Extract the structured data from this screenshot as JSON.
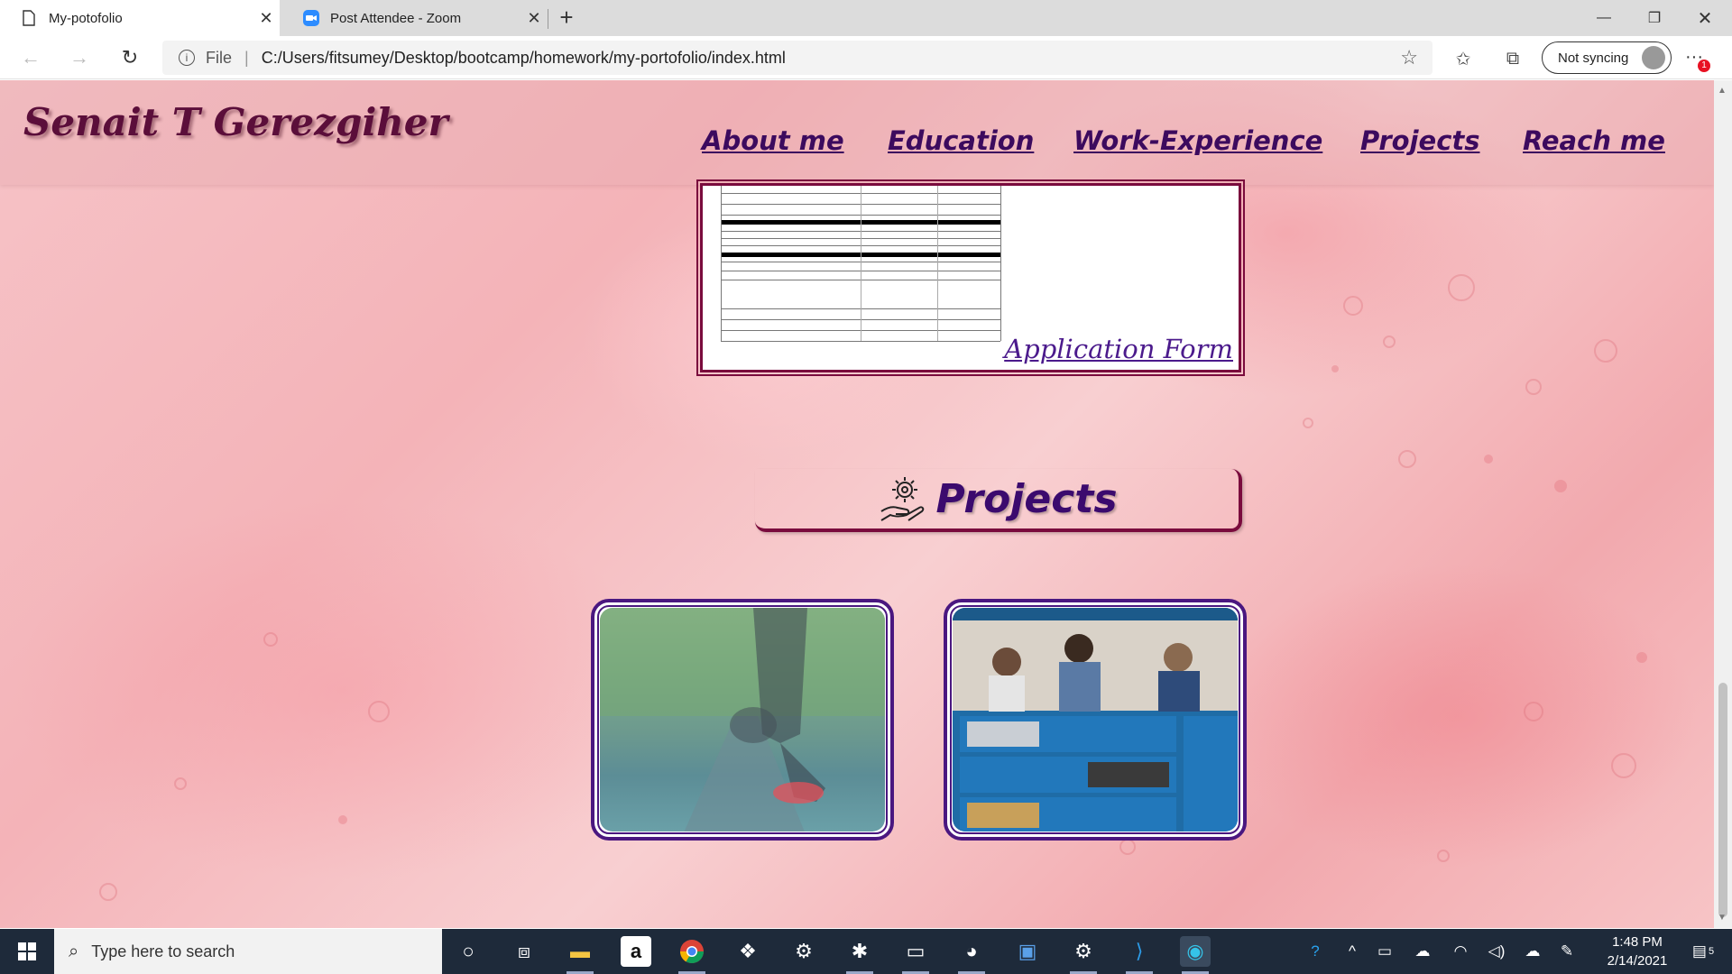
{
  "browser": {
    "tabs": [
      {
        "label": "My-potofolio",
        "active": true
      },
      {
        "label": "Post Attendee - Zoom",
        "active": false
      }
    ],
    "address": {
      "file_label": "File",
      "separator": "|",
      "url": "C:/Users/fitsumey/Desktop/bootcamp/homework/my-portofolio/index.html"
    },
    "sync_label": "Not syncing",
    "notification_count": "1"
  },
  "site": {
    "title": "Senait T Gerezgiher",
    "nav": [
      "About me",
      "Education",
      "Work-Experience",
      "Projects",
      "Reach me"
    ],
    "application_link": "Application Form",
    "projects_heading": "Projects"
  },
  "taskbar": {
    "search_placeholder": "Type here to search",
    "time": "1:48 PM",
    "date": "2/14/2021",
    "notification_count": "5"
  },
  "colors": {
    "title": "#5b0e3a",
    "nav": "#3c0a5e",
    "card_border": "#7a0b3d",
    "project_border": "#4a1780",
    "taskbar": "#1e2a3a"
  }
}
